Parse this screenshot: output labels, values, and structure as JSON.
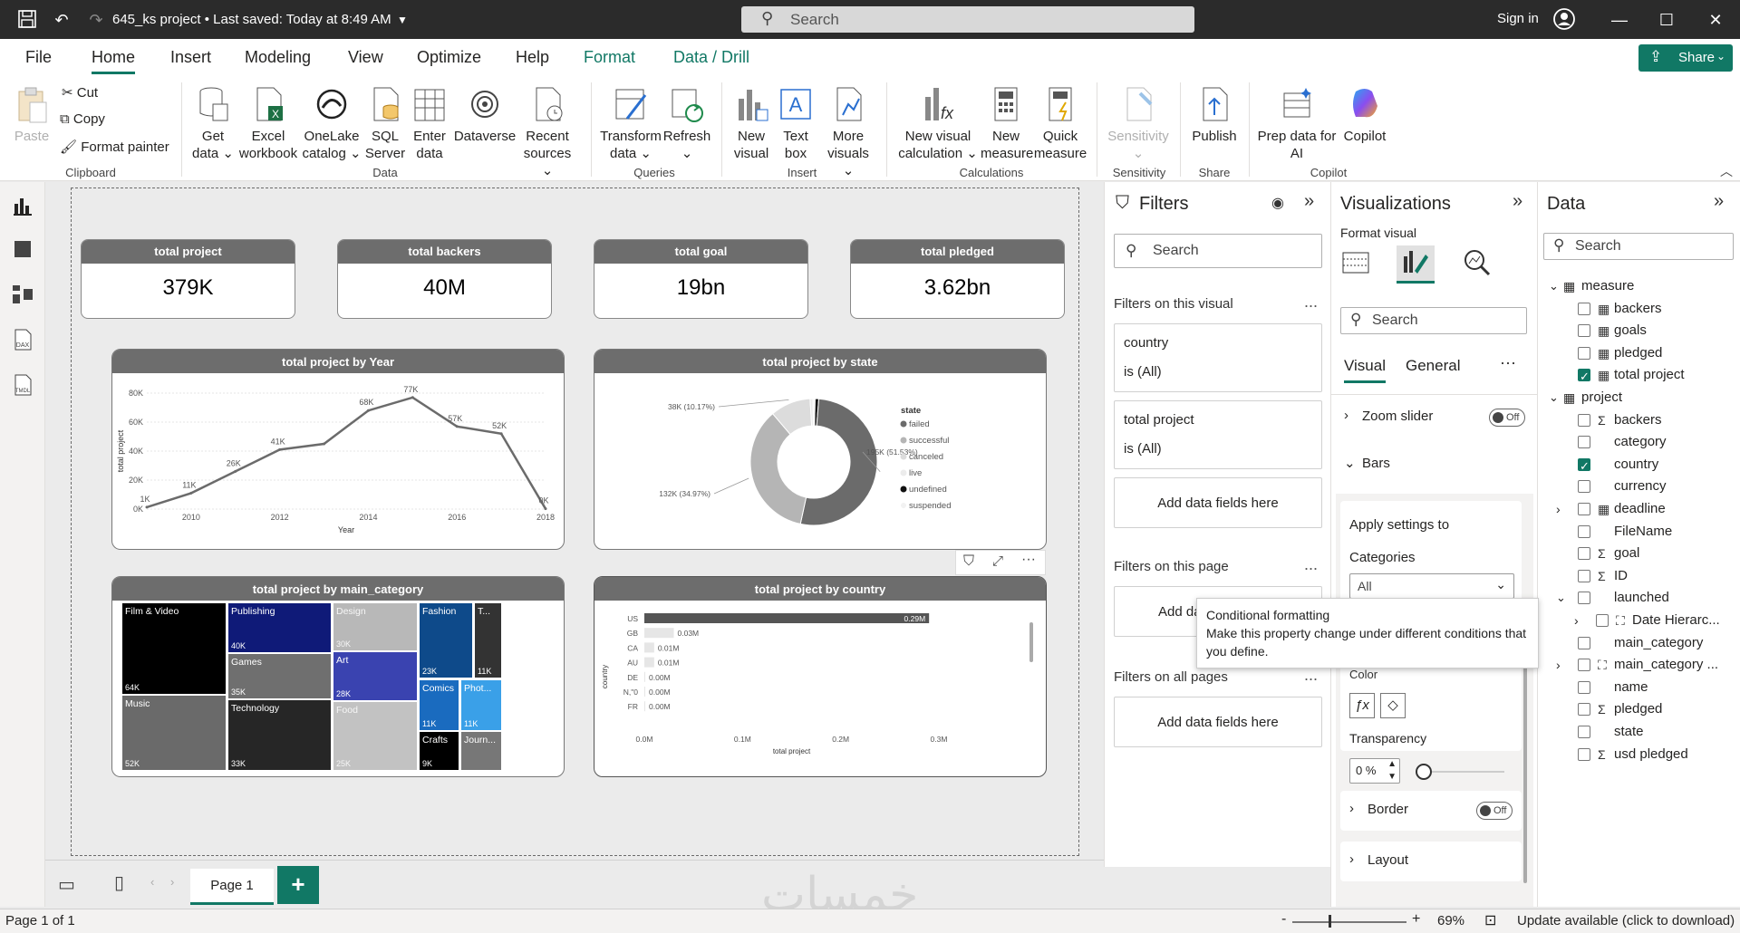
{
  "titlebar": {
    "doc_title": "645_ks project • Last saved: Today at 8:49 AM",
    "search_placeholder": "Search",
    "sign_in": "Sign in"
  },
  "menu": {
    "tabs": [
      "File",
      "Home",
      "Insert",
      "Modeling",
      "View",
      "Optimize",
      "Help",
      "Format",
      "Data / Drill"
    ],
    "active": "Home",
    "share_label": "Share"
  },
  "ribbon": {
    "clipboard": {
      "paste": "Paste",
      "cut": "Cut",
      "copy": "Copy",
      "format_painter": "Format painter",
      "group": "Clipboard"
    },
    "data": {
      "get_data": [
        "Get",
        "data ⌄"
      ],
      "excel": [
        "Excel",
        "workbook"
      ],
      "onelake": [
        "OneLake",
        "catalog ⌄"
      ],
      "sql": [
        "SQL",
        "Server"
      ],
      "enter": [
        "Enter",
        "data"
      ],
      "dataverse": [
        "Dataverse"
      ],
      "recent": [
        "Recent",
        "sources ⌄"
      ],
      "group": "Data"
    },
    "queries": {
      "transform": [
        "Transform",
        "data ⌄"
      ],
      "refresh": [
        "Refresh",
        "⌄"
      ],
      "group": "Queries"
    },
    "insert": {
      "new_visual": [
        "New",
        "visual"
      ],
      "text_box": [
        "Text",
        "box"
      ],
      "more_visuals": [
        "More",
        "visuals ⌄"
      ],
      "group": "Insert"
    },
    "calculations": {
      "new_visual_calc": [
        "New visual",
        "calculation ⌄"
      ],
      "new_measure": [
        "New",
        "measure"
      ],
      "quick_measure": [
        "Quick",
        "measure"
      ],
      "group": "Calculations"
    },
    "sensitivity": {
      "label": [
        "Sensitivity",
        "⌄"
      ],
      "group": "Sensitivity"
    },
    "share": {
      "publish": [
        "Publish"
      ],
      "group": "Share"
    },
    "copilot": {
      "prep": [
        "Prep data for",
        "AI"
      ],
      "copilot": [
        "Copilot"
      ],
      "group": "Copilot"
    }
  },
  "cards": [
    {
      "title": "total project",
      "value": "379K"
    },
    {
      "title": "total backers",
      "value": "40M"
    },
    {
      "title": "total goal",
      "value": "19bn"
    },
    {
      "title": "total pledged",
      "value": "3.62bn"
    }
  ],
  "visual_titles": {
    "line": "total project by Year",
    "donut": "total project by state",
    "treemap": "total project by main_category",
    "bar": "total project by country"
  },
  "chart_data": [
    {
      "type": "line",
      "title": "total project by Year",
      "xlabel": "Year",
      "ylabel": "total project",
      "x": [
        2009,
        2010,
        2011,
        2012,
        2013,
        2014,
        2015,
        2016,
        2017,
        2018
      ],
      "values": [
        1.3,
        11,
        26,
        41,
        45,
        68,
        77,
        57,
        52,
        0.2
      ],
      "data_labels": [
        "1K",
        "11K",
        "26K",
        "41K",
        "",
        "68K",
        "77K",
        "57K",
        "52K",
        "0K"
      ],
      "x_ticks": [
        "2010",
        "2012",
        "2014",
        "2016",
        "2018"
      ],
      "y_ticks": [
        "0K",
        "20K",
        "40K",
        "60K",
        "80K"
      ],
      "ylim": [
        0,
        80
      ],
      "color": "#6b6b6b"
    },
    {
      "type": "pie",
      "title": "total project by state",
      "legend_title": "state",
      "legend_position": "right",
      "categories": [
        "failed",
        "successful",
        "canceled",
        "live",
        "undefined",
        "suspended"
      ],
      "values": [
        51.53,
        34.97,
        10.17,
        0.74,
        0.95,
        0.49
      ],
      "colors": [
        "#6b6b6b",
        "#b5b5b5",
        "#dcdcdc",
        "#ececec",
        "#111111",
        "#f2f2f2"
      ],
      "data_labels": [
        "195K (51.53%)",
        "132K (34.97%)",
        "38K (10.17%)",
        "",
        "",
        ""
      ]
    },
    {
      "type": "heatmap",
      "title": "total project by main_category",
      "tiles": [
        {
          "name": "Film & Video",
          "value": "64K",
          "color": "#000000"
        },
        {
          "name": "Music",
          "value": "52K",
          "color": "#6a6a6a"
        },
        {
          "name": "Publishing",
          "value": "40K",
          "color": "#0f1a78"
        },
        {
          "name": "Games",
          "value": "35K",
          "color": "#6f6f6f"
        },
        {
          "name": "Technology",
          "value": "33K",
          "color": "#262626"
        },
        {
          "name": "Design",
          "value": "30K",
          "color": "#b8b8b8"
        },
        {
          "name": "Art",
          "value": "28K",
          "color": "#3a43b0"
        },
        {
          "name": "Food",
          "value": "25K",
          "color": "#c2c2c2"
        },
        {
          "name": "Fashion",
          "value": "23K",
          "color": "#0e4a8a"
        },
        {
          "name": "T...",
          "value": "11K",
          "color": "#333333"
        },
        {
          "name": "Comics",
          "value": "11K",
          "color": "#1a6bbf"
        },
        {
          "name": "Phot...",
          "value": "11K",
          "color": "#3aa0e8"
        },
        {
          "name": "Crafts",
          "value": "9K",
          "color": "#000000"
        },
        {
          "name": "Journ...",
          "value": "",
          "color": "#777777"
        }
      ]
    },
    {
      "type": "bar",
      "title": "total project by country",
      "xlabel": "total project",
      "ylabel": "country",
      "categories": [
        "US",
        "GB",
        "CA",
        "AU",
        "DE",
        "N,\"0",
        "FR"
      ],
      "values": [
        0.29,
        0.03,
        0.01,
        0.01,
        0.0,
        0.0,
        0.0
      ],
      "data_labels": [
        "0.29M",
        "0.03M",
        "0.01M",
        "0.01M",
        "0.00M",
        "0.00M",
        "0.00M"
      ],
      "x_ticks": [
        "0.0M",
        "0.1M",
        "0.2M",
        "0.3M"
      ],
      "xlim": [
        0,
        0.3
      ],
      "colors": [
        "#555555",
        "#e6e6e6"
      ]
    }
  ],
  "filters": {
    "title": "Filters",
    "search_placeholder": "Search",
    "on_visual": "Filters on this visual",
    "cards": [
      {
        "field": "country",
        "state": "is (All)"
      },
      {
        "field": "total project",
        "state": "is (All)"
      }
    ],
    "add_fields": "Add data fields here",
    "add_fields_short": "Add da",
    "on_page": "Filters on this page",
    "on_all": "Filters on all pages",
    "dots": "..."
  },
  "viz": {
    "title": "Visualizations",
    "format_visual": "Format visual",
    "search_placeholder": "Search",
    "tab_visual": "Visual",
    "tab_general": "General",
    "dots": "···",
    "zoom_slider": "Zoom slider",
    "bars": "Bars",
    "apply_settings": "Apply settings to",
    "categories_label": "Categories",
    "categories_value": "All",
    "color_label": "Color",
    "transparency_label": "Transparency",
    "transparency_value": "0 %",
    "border": "Border",
    "layout": "Layout",
    "off": "Off"
  },
  "tooltip": {
    "title": "Conditional formatting",
    "body": "Make this property change under different conditions that you define."
  },
  "datapane": {
    "title": "Data",
    "search_placeholder": "Search",
    "measure_table": "measure",
    "measures": [
      {
        "name": "backers",
        "checked": false
      },
      {
        "name": "goals",
        "checked": false
      },
      {
        "name": "pledged",
        "checked": false
      },
      {
        "name": "total project",
        "checked": true
      }
    ],
    "project_table": "project",
    "fields": [
      {
        "name": "backers",
        "icon": "Σ",
        "checked": false,
        "expand": false
      },
      {
        "name": "category",
        "icon": "",
        "checked": false,
        "expand": false
      },
      {
        "name": "country",
        "icon": "",
        "checked": true,
        "expand": false
      },
      {
        "name": "currency",
        "icon": "",
        "checked": false,
        "expand": false
      },
      {
        "name": "deadline",
        "icon": "▦",
        "checked": false,
        "expand": true
      },
      {
        "name": "FileName",
        "icon": "",
        "checked": false,
        "expand": false
      },
      {
        "name": "goal",
        "icon": "Σ",
        "checked": false,
        "expand": false
      },
      {
        "name": "ID",
        "icon": "Σ",
        "checked": false,
        "expand": false
      },
      {
        "name": "launched",
        "icon": "",
        "checked": false,
        "expand": "open"
      },
      {
        "name": "Date Hierarc...",
        "icon": "⛶",
        "checked": false,
        "expand": "child"
      },
      {
        "name": "main_category",
        "icon": "",
        "checked": false,
        "expand": false
      },
      {
        "name": "main_category ...",
        "icon": "⛶",
        "checked": false,
        "expand": true
      },
      {
        "name": "name",
        "icon": "",
        "checked": false,
        "expand": false
      },
      {
        "name": "pledged",
        "icon": "Σ",
        "checked": false,
        "expand": false
      },
      {
        "name": "state",
        "icon": "",
        "checked": false,
        "expand": false
      },
      {
        "name": "usd pledged",
        "icon": "Σ",
        "checked": false,
        "expand": false
      }
    ]
  },
  "pagebar": {
    "page_tab": "Page 1",
    "add": "+"
  },
  "statusbar": {
    "page_info": "Page 1 of 1",
    "zoom": "69%",
    "update": "Update available (click to download)",
    "minus": "-",
    "plus": "+"
  },
  "watermark": "خمسات"
}
